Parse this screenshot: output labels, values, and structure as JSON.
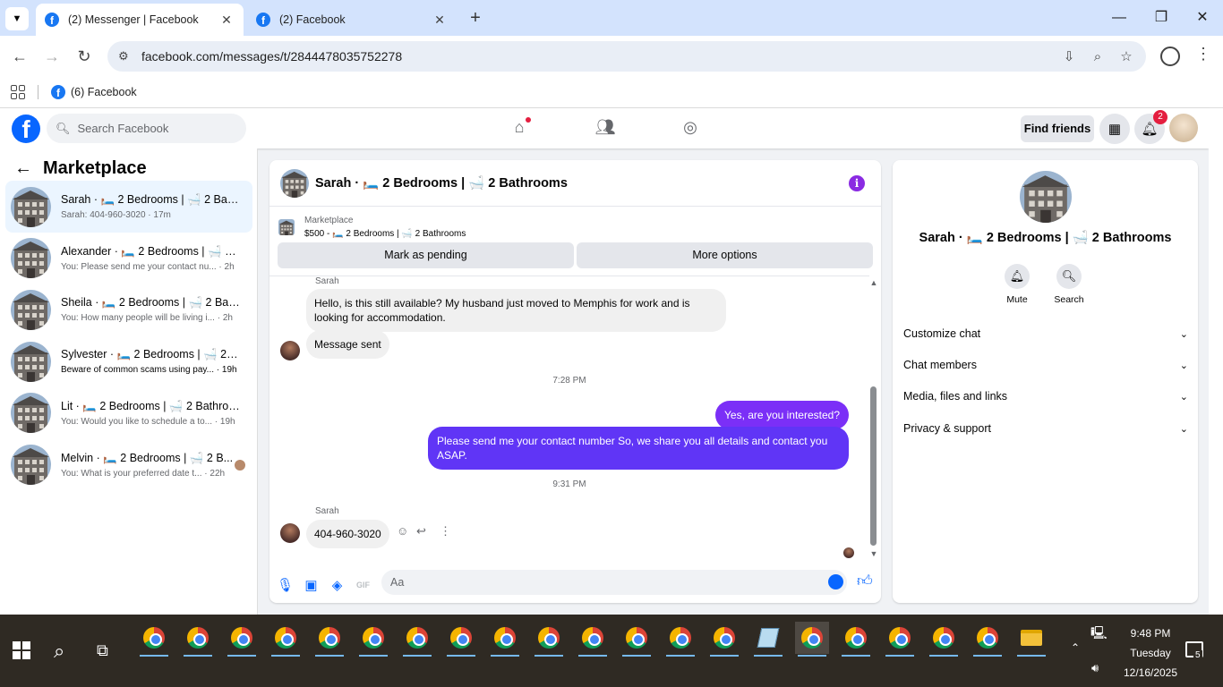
{
  "browser": {
    "tabs": [
      {
        "title": "(2) Messenger | Facebook",
        "active": true
      },
      {
        "title": "(2) Facebook",
        "active": false
      }
    ],
    "url": "facebook.com/messages/t/2844478035752278",
    "bookmark": "(6) Facebook"
  },
  "fb": {
    "logo": "f",
    "search_placeholder": "Search Facebook",
    "find_friends": "Find friends",
    "notif_count": "2"
  },
  "sidebar": {
    "title": "Marketplace",
    "conversations": [
      {
        "name": "Sarah · 🛏️ 2 Bedrooms | 🛁 2 Bath...",
        "preview": "Sarah: 404-960-3020 · 17m"
      },
      {
        "name": "Alexander · 🛏️ 2 Bedrooms | 🛁 2 ...",
        "preview": "You: Please send me your contact nu... · 2h"
      },
      {
        "name": "Sheila · 🛏️ 2 Bedrooms | 🛁 2 Bath...",
        "preview": "You: How many people will be living i... · 2h"
      },
      {
        "name": "Sylvester · 🛏️ 2 Bedrooms | 🛁 2 B...",
        "preview": "Beware of common scams using pay... · 19h"
      },
      {
        "name": "Lit · 🛏️ 2 Bedrooms | 🛁 2 Bathroo...",
        "preview": "You: Would you like to schedule a to... · 19h"
      },
      {
        "name": "Melvin · 🛏️ 2 Bedrooms | 🛁 2 B...",
        "preview": "You: What is your preferred date t... · 22h"
      }
    ]
  },
  "chat": {
    "title": "Sarah · 🛏️ 2 Bedrooms | 🛁 2 Bathrooms",
    "marketplace_label": "Marketplace",
    "listing": "$500 - 🛏️ 2 Bedrooms | 🛁 2 Bathrooms",
    "mark_pending": "Mark as pending",
    "more_options": "More options",
    "sender1": "Sarah",
    "msg1": "Hello, is this still available? My husband just moved to Memphis for work and is looking for accommodation.",
    "msg2": "Message sent",
    "time1": "7:28 PM",
    "out1": "Yes, are you interested?",
    "out2": "Please send me your contact number So, we share you all details and contact you ASAP.",
    "time2": "9:31 PM",
    "sender2": "Sarah",
    "msg3": "404-960-3020",
    "input_placeholder": "Aa"
  },
  "details": {
    "title": "Sarah · 🛏️ 2 Bedrooms | 🛁 2 Bathrooms",
    "mute": "Mute",
    "search": "Search",
    "sections": [
      "Customize chat",
      "Chat members",
      "Media, files and links",
      "Privacy & support"
    ]
  },
  "taskbar": {
    "time": "9:48 PM",
    "day": "Tuesday",
    "date": "12/16/2025",
    "notif_count": "5"
  },
  "colors": {
    "fb_blue": "#0866ff",
    "outgoing_bubble": "#6035f6",
    "badge_red": "#e41e3f"
  }
}
